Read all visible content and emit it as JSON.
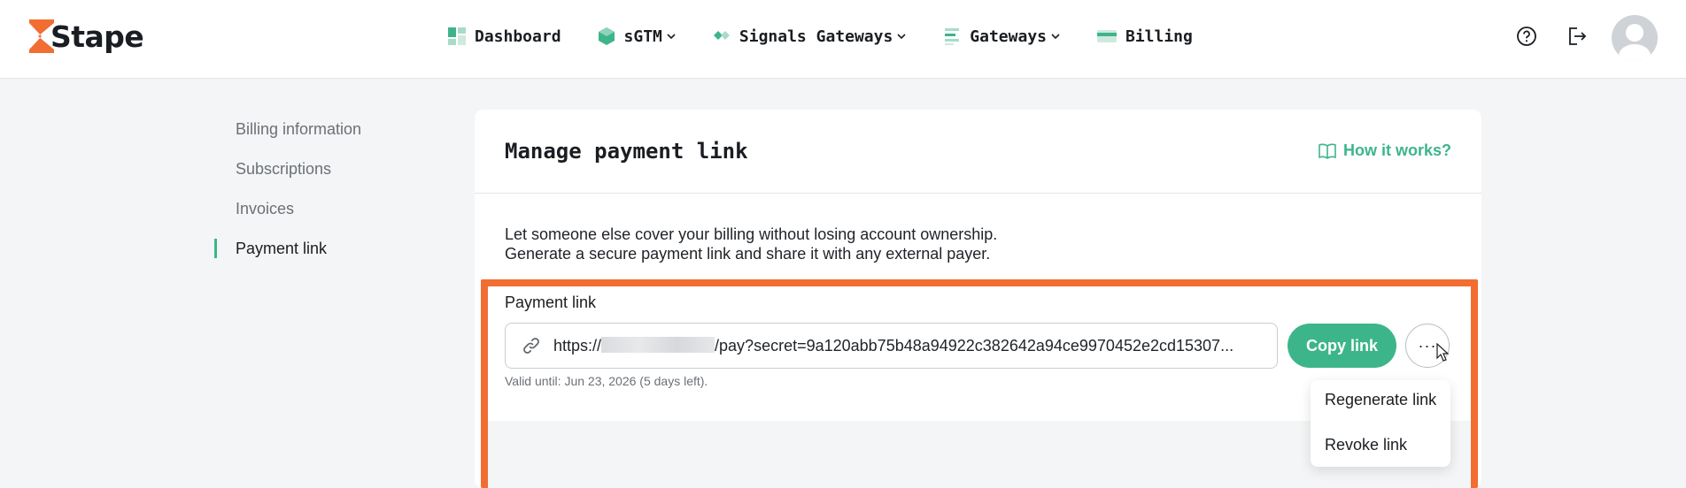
{
  "brand": {
    "name": "Stape",
    "accent": "#3db58a",
    "logo_color": "#f26d32"
  },
  "nav": [
    {
      "label": "Dashboard",
      "icon": "dashboard-icon",
      "dropdown": false
    },
    {
      "label": "sGTM",
      "icon": "cube-icon",
      "dropdown": true
    },
    {
      "label": "Signals Gateways",
      "icon": "diamonds-icon",
      "dropdown": true
    },
    {
      "label": "Gateways",
      "icon": "stack-icon",
      "dropdown": true
    },
    {
      "label": "Billing",
      "icon": "card-icon",
      "dropdown": false
    }
  ],
  "header_icons": [
    "help-icon",
    "logout-icon",
    "avatar"
  ],
  "sidebar": {
    "items": [
      {
        "label": "Billing information",
        "active": false
      },
      {
        "label": "Subscriptions",
        "active": false
      },
      {
        "label": "Invoices",
        "active": false
      },
      {
        "label": "Payment link",
        "active": true
      }
    ]
  },
  "card": {
    "title": "Manage payment link",
    "how_it_works": "How it works?",
    "description_line1": "Let someone else cover your billing without losing account ownership.",
    "description_line2": "Generate a secure payment link and share it with any external payer."
  },
  "payment_link": {
    "label": "Payment link",
    "url_prefix": "https://",
    "url_suffix": "/pay?secret=9a120abb75b48a94922c382642a94ce9970452e2cd15307...",
    "valid_until": "Valid until: Jun 23, 2026 (5 days left).",
    "copy_label": "Copy link",
    "more_label": "···"
  },
  "menu": {
    "items": [
      "Regenerate link",
      "Revoke link"
    ]
  },
  "highlight_color": "#f26d32"
}
